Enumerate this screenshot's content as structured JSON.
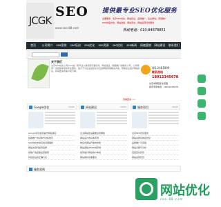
{
  "header": {
    "logo_jcgk": "JCGK",
    "logo_seo": "SEO",
    "url": "www.seo-88.com",
    "slogan": "提供最专业SEO优化服务",
    "sub1": "主要服务：北京SEO优化，网站建设，品牌推广，企业网站，营销推广",
    "sub2": "PRO排名优化，网站改版，网站安全，网站运营托管服务",
    "hotline": "热线电话：010-84678851"
  },
  "nav": [
    "首页",
    "公司简介",
    "seo案例",
    "seo培训",
    "seo优化",
    "seo资源",
    "seo优化",
    "seo新闻",
    "网络营销",
    "网站建设",
    "联系我们"
  ],
  "intro": {
    "title": "关于我们",
    "text": "北京SEO优化公司JCGK是一家专业从事搜索引擎优化、网站建设、网络推广的服务公司，公司拥有一支经验丰富的专业团队，致力于为企业提供全方位的网络营销解决方案，帮助企业提升网站排名，获得更多的客户和订单。",
    "more": "查看更多 >>"
  },
  "contact": {
    "qq": "QQ:2481899",
    "phone_title": "联系热线",
    "phone": "18912345678",
    "addr1": "北京市朝阳区北苑路",
    "addr2": "顾问专家电话：18912345678"
  },
  "sections": [
    {
      "title": "Google优化",
      "more": "MORE",
      "items": [
        "Google优化如何提升网站排名",
        "谷歌推广的具体方法和技巧",
        "SEO优化中常见的问题解析",
        "网站关键词如何选择",
        "谷歌广告投放注意事项",
        "外链建设的正确方法"
      ]
    },
    {
      "title": "网站建设",
      "more": "MORE",
      "items": [
        "企业网站建设需要注意哪些",
        "网站设计的基本原则",
        "响应式网站开发的优势",
        "网站改版对SEO的影响",
        "如何提升网站用户体验",
        "网站维护的重要性"
      ]
    },
    {
      "title": "服务项目",
      "more": "MORE",
      "items": [
        "北京SEO优化服务",
        "网站关键词排名优化",
        "品牌推广与营销",
        "网站诊断与分析",
        "百度竞价托管",
        "网站运营托管"
      ]
    }
  ],
  "bottom": {
    "title": "服务案例"
  },
  "watermark": {
    "text": "网站优化",
    "sub": "seo-88.com"
  }
}
